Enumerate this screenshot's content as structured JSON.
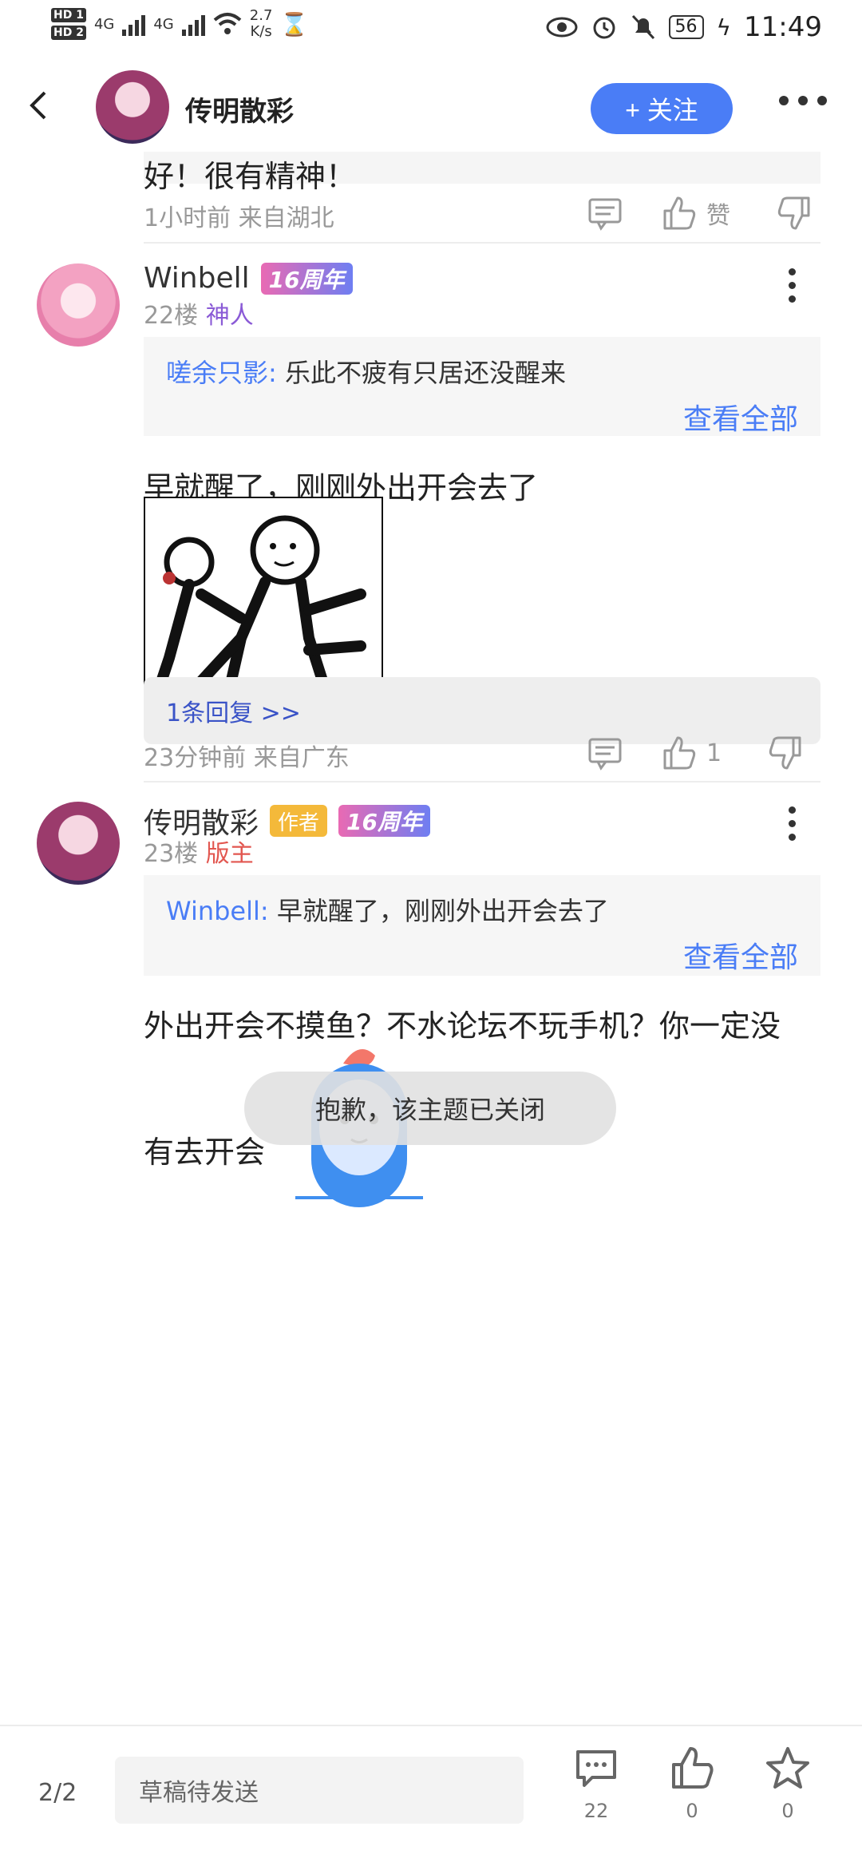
{
  "status_bar": {
    "hd1": "HD 1",
    "hd2": "HD 2",
    "net1": "4G",
    "net2": "4G",
    "speed_value": "2.7",
    "speed_unit": "K/s",
    "battery": "56",
    "time": "11:49"
  },
  "header": {
    "name": "传明散彩",
    "follow_label": "+ 关注"
  },
  "post_top": {
    "text": "好！很有精神！",
    "meta": "1小时前 来自湖北",
    "like_label": "赞"
  },
  "comment1": {
    "name": "Winbell",
    "badge": "16周年",
    "floor": "22楼",
    "title": "神人",
    "quote_author": "嗟余只影:",
    "quote_text": "乐此不疲有只居还没醒来",
    "view_all": "查看全部",
    "text": "早就醒了，刚刚外出开会去了",
    "replies": "1条回复 >>",
    "meta": "23分钟前 来自广东",
    "likes": "1"
  },
  "comment2": {
    "name": "传明散彩",
    "author_badge": "作者",
    "badge": "16周年",
    "floor": "23楼",
    "title": "版主",
    "quote_author": "Winbell:",
    "quote_text": "早就醒了，刚刚外出开会去了",
    "view_all": "查看全部",
    "text_line1": "外出开会不摸鱼？不水论坛不玩手机？你一定没",
    "text_line2": "有去开会"
  },
  "toast": "抱歉，该主题已关闭",
  "bottom_bar": {
    "page": "2/2",
    "draft_placeholder": "草稿待发送",
    "comments_count": "22",
    "likes_count": "0",
    "favorites_count": "0"
  },
  "colors": {
    "accent": "#4a7df6",
    "moderator_red": "#e2564f",
    "title_purple": "#8a5ad6",
    "author_orange": "#f4b93a"
  }
}
